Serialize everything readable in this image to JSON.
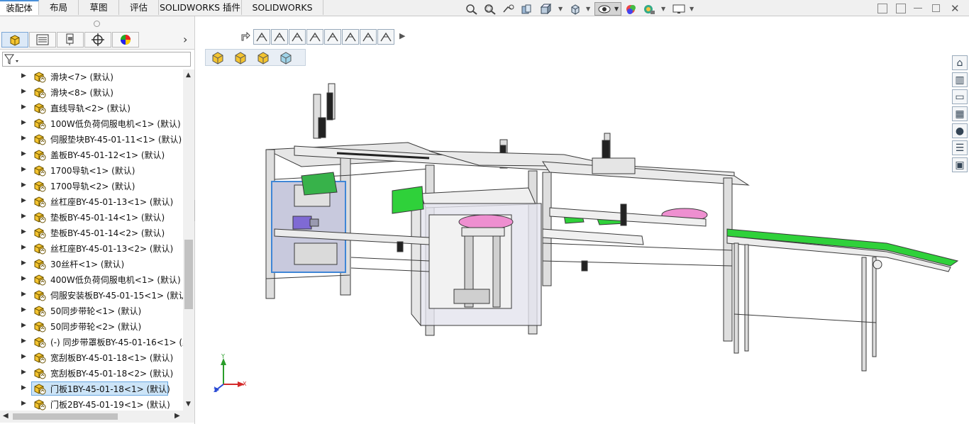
{
  "ribbon_tabs": [
    {
      "label": "装配体",
      "active": true
    },
    {
      "label": "布局"
    },
    {
      "label": "草图"
    },
    {
      "label": "评估"
    },
    {
      "label": "SOLIDWORKS 插件"
    },
    {
      "label": "SOLIDWORKS MBD"
    }
  ],
  "heads_up_icons": [
    "zoom-to-fit-icon",
    "zoom-area-icon",
    "previous-view-icon",
    "section-view-icon",
    "view-orientation-icon",
    "display-style-icon",
    "hide-show-icon",
    "edit-appearance-icon",
    "apply-scene-icon",
    "view-settings-icon"
  ],
  "feature_tree": {
    "panel_tabs": [
      "featuremanager-icon",
      "propertymanager-icon",
      "configurationmanager-icon",
      "dimxpert-icon",
      "displaymanager-icon"
    ],
    "filter_icon": "filter-icon",
    "items": [
      {
        "label": "滑块<7> (默认)"
      },
      {
        "label": "滑块<8> (默认)"
      },
      {
        "label": "直线导轨<2> (默认)"
      },
      {
        "label": "100W低负荷伺服电机<1> (默认)"
      },
      {
        "label": "伺服垫块BY-45-01-11<1> (默认)"
      },
      {
        "label": "盖板BY-45-01-12<1> (默认)"
      },
      {
        "label": "1700导轨<1> (默认)"
      },
      {
        "label": "1700导轨<2> (默认)"
      },
      {
        "label": "丝杠座BY-45-01-13<1> (默认)"
      },
      {
        "label": "垫板BY-45-01-14<1> (默认)"
      },
      {
        "label": "垫板BY-45-01-14<2> (默认)"
      },
      {
        "label": "丝杠座BY-45-01-13<2> (默认)"
      },
      {
        "label": "30丝杆<1> (默认)"
      },
      {
        "label": "400W低负荷伺服电机<1> (默认)"
      },
      {
        "label": "伺服安装板BY-45-01-15<1> (默认"
      },
      {
        "label": "50同步带轮<1> (默认)"
      },
      {
        "label": "50同步带轮<2> (默认)"
      },
      {
        "label": "(-) 同步带罩板BY-45-01-16<1> (默"
      },
      {
        "label": "宽刮板BY-45-01-18<1> (默认)"
      },
      {
        "label": "宽刮板BY-45-01-18<2> (默认)"
      },
      {
        "label": "门板1BY-45-01-18<1> (默认)",
        "selected": true
      },
      {
        "label": "门板2BY-45-01-19<1> (默认)"
      }
    ]
  },
  "triad": {
    "x": "X",
    "y": "Y",
    "z": "Z"
  },
  "task_pane": [
    "home-icon",
    "design-library-icon",
    "file-explorer-icon",
    "view-palette-icon",
    "appearances-icon",
    "custom-properties-icon",
    "forum-icon"
  ],
  "colors": {
    "accent": "#4a90d9",
    "green": "#2fd13a",
    "pink": "#ee8fd0",
    "purple": "#8d6fd9"
  }
}
